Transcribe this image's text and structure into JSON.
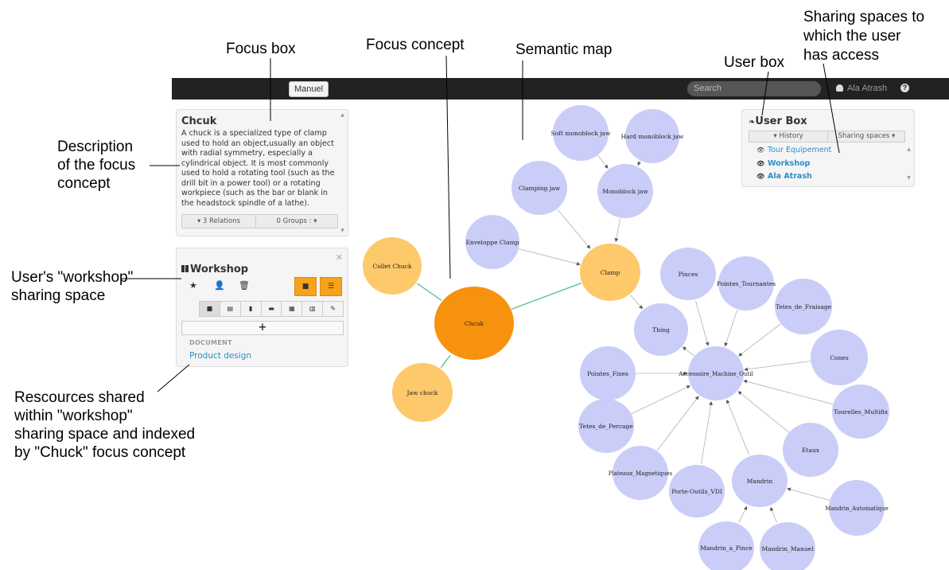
{
  "annotations": {
    "focus_box": "Focus box",
    "focus_concept": "Focus concept",
    "semantic_map": "Semantic map",
    "user_box": "User box",
    "sharing_spaces": [
      "Sharing spaces to",
      "which the user",
      "has access"
    ],
    "description": [
      "Description",
      "of the focus",
      "concept"
    ],
    "workshop_space": [
      "User's \"workshop\"",
      "sharing space"
    ],
    "resources": [
      "Rescources shared",
      "within  \"workshop\"",
      "sharing space and indexed",
      "by \"Chuck\" focus concept"
    ]
  },
  "topbar": {
    "manuel_label": "Manuel",
    "search_placeholder": "Search",
    "user_name": "Ala Atrash",
    "help_icon": "?"
  },
  "focus_box": {
    "title": "Chcuk",
    "description": "A chuck is a specialized type of clamp used to hold an object,usually an object with radial symmetry, especially a cylindrical object. It is most commonly used to hold a rotating tool (such as the drill bit in a power tool) or a rotating workpiece (such as the bar or blank in the headstock spindle of a lathe).",
    "relations_label": "3 Relations",
    "groups_label": "0 Groups :"
  },
  "workshop_box": {
    "title": "Workshop",
    "section_label": "DOCUMENT",
    "items": [
      "Product design"
    ]
  },
  "user_box": {
    "title": "User Box",
    "history_label": "History",
    "sharing_label": "Sharing spaces",
    "items": [
      "Tour Equipement",
      "Workshop",
      "Ala Atrash"
    ]
  },
  "semantic_map": {
    "node_colors": {
      "focus": "#f7920e",
      "related": "#fdc96a",
      "concept": "#cacdf7"
    },
    "edge_colors": {
      "focus": "#5fc38c",
      "concept": "#b0b0b0"
    },
    "nodes": [
      {
        "id": "chcuk",
        "label": "Chcuk",
        "kind": "focus"
      },
      {
        "id": "collet",
        "label": "Collet Chuck",
        "kind": "related"
      },
      {
        "id": "jawchuck",
        "label": "Jaw chuck",
        "kind": "related"
      },
      {
        "id": "clamp",
        "label": "Clamp",
        "kind": "related"
      },
      {
        "id": "softjaw",
        "label": "Soft monoblock jaw",
        "kind": "concept"
      },
      {
        "id": "hardjaw",
        "label": "Hard monoblock jaw",
        "kind": "concept"
      },
      {
        "id": "clampjaw",
        "label": "Clamping jaw",
        "kind": "concept"
      },
      {
        "id": "monoblock",
        "label": "Monoblock jaw",
        "kind": "concept"
      },
      {
        "id": "enveloppe",
        "label": "Enveloppe Clamp",
        "kind": "concept"
      },
      {
        "id": "thing",
        "label": "Thing",
        "kind": "concept"
      },
      {
        "id": "pinces",
        "label": "Pinces",
        "kind": "concept"
      },
      {
        "id": "pointes_t",
        "label": "Pointes_Tournantes",
        "kind": "concept"
      },
      {
        "id": "tetes_f",
        "label": "Tetes_de_Fraisage",
        "kind": "concept"
      },
      {
        "id": "cones",
        "label": "Cones",
        "kind": "concept"
      },
      {
        "id": "acc",
        "label": "Accessoire_Machine_Outil",
        "kind": "concept"
      },
      {
        "id": "pointes_f",
        "label": "Pointes_Fixes",
        "kind": "concept"
      },
      {
        "id": "tourelles",
        "label": "Tourelles_Multifix",
        "kind": "concept"
      },
      {
        "id": "tetes_p",
        "label": "Tetes_de_Percage",
        "kind": "concept"
      },
      {
        "id": "etaux",
        "label": "Etaux",
        "kind": "concept"
      },
      {
        "id": "plateaux",
        "label": "Plateaux_Magnetiques",
        "kind": "concept"
      },
      {
        "id": "porte",
        "label": "Porte-Outils_VDI",
        "kind": "concept"
      },
      {
        "id": "mandrin",
        "label": "Mandrin",
        "kind": "concept"
      },
      {
        "id": "mandrin_auto",
        "label": "Mandrin_Automatique",
        "kind": "concept"
      },
      {
        "id": "mandrin_pince",
        "label": "Mandrin_a_Pince",
        "kind": "concept"
      },
      {
        "id": "mandrin_manuel",
        "label": "Mandrin_Manuel",
        "kind": "concept"
      }
    ],
    "edges": [
      [
        "chcuk",
        "collet"
      ],
      [
        "chcuk",
        "jawchuck"
      ],
      [
        "chcuk",
        "clamp"
      ],
      [
        "softjaw",
        "monoblock"
      ],
      [
        "hardjaw",
        "monoblock"
      ],
      [
        "clampjaw",
        "clamp"
      ],
      [
        "monoblock",
        "clamp"
      ],
      [
        "enveloppe",
        "clamp"
      ],
      [
        "clamp",
        "thing"
      ],
      [
        "acc",
        "thing"
      ],
      [
        "pinces",
        "acc"
      ],
      [
        "pointes_t",
        "acc"
      ],
      [
        "tetes_f",
        "acc"
      ],
      [
        "cones",
        "acc"
      ],
      [
        "pointes_f",
        "acc"
      ],
      [
        "tourelles",
        "acc"
      ],
      [
        "tetes_p",
        "acc"
      ],
      [
        "etaux",
        "acc"
      ],
      [
        "plateaux",
        "acc"
      ],
      [
        "porte",
        "acc"
      ],
      [
        "mandrin",
        "acc"
      ],
      [
        "mandrin_auto",
        "mandrin"
      ],
      [
        "mandrin_pince",
        "mandrin"
      ],
      [
        "mandrin_manuel",
        "mandrin"
      ]
    ]
  }
}
